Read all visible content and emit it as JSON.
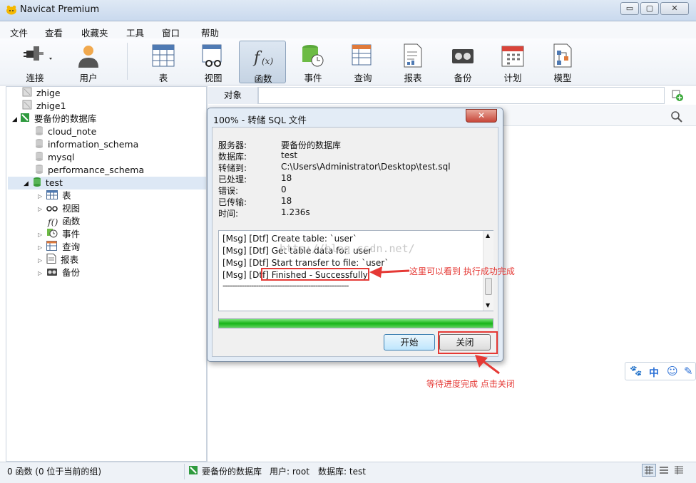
{
  "window": {
    "title": "Navicat Premium",
    "minimize": "▭",
    "maximize": "▢",
    "close": "✕"
  },
  "menu": [
    "文件",
    "查看",
    "收藏夹",
    "工具",
    "窗口",
    "帮助"
  ],
  "toolbar": [
    "连接",
    "用户",
    "表",
    "视图",
    "函数",
    "事件",
    "查询",
    "报表",
    "备份",
    "计划",
    "模型"
  ],
  "tree": {
    "connections": [
      "zhige",
      "zhige1",
      "要备份的数据库"
    ],
    "databases": [
      "cloud_note",
      "information_schema",
      "mysql",
      "performance_schema",
      "test"
    ],
    "objects": [
      "表",
      "视图",
      "函数",
      "事件",
      "查询",
      "报表",
      "备份"
    ]
  },
  "tabs": {
    "objects": "对象"
  },
  "dialog": {
    "title": "100% - 转储 SQL 文件",
    "info": [
      {
        "k": "服务器:",
        "v": "要备份的数据库"
      },
      {
        "k": "数据库:",
        "v": "test"
      },
      {
        "k": "转储到:",
        "v": "C:\\Users\\Administrator\\Desktop\\test.sql"
      },
      {
        "k": "已处理:",
        "v": "18"
      },
      {
        "k": "错误:",
        "v": "0"
      },
      {
        "k": "已传输:",
        "v": "18"
      },
      {
        "k": "时间:",
        "v": "1.236s"
      }
    ],
    "log": [
      "[Msg] [Dtf] Create table: `user`",
      "[Msg] [Dtf] Get table data for: user",
      "[Msg] [Dtf] Start transfer to file: `user`",
      "[Msg] [Dtf] Finished - Successfully",
      "-----------------------------------------------------"
    ],
    "progress": 1.0,
    "start_button": "开始",
    "close_button": "关闭"
  },
  "annotations": {
    "success_note": "这里可以看到 执行成功完成",
    "close_note": "等待进度完成 点击关闭"
  },
  "watermark": "http://blog.csdn.net/",
  "status": {
    "left": "0 函数 (0 位于当前的组)",
    "connection": "要备份的数据库",
    "user": "用户: root",
    "database": "数据库: test"
  },
  "ime": {
    "lang": "中"
  },
  "colors": {
    "accent_red": "#e53935",
    "progress_green": "#17b417",
    "title_blue": "#c9d9ee"
  }
}
